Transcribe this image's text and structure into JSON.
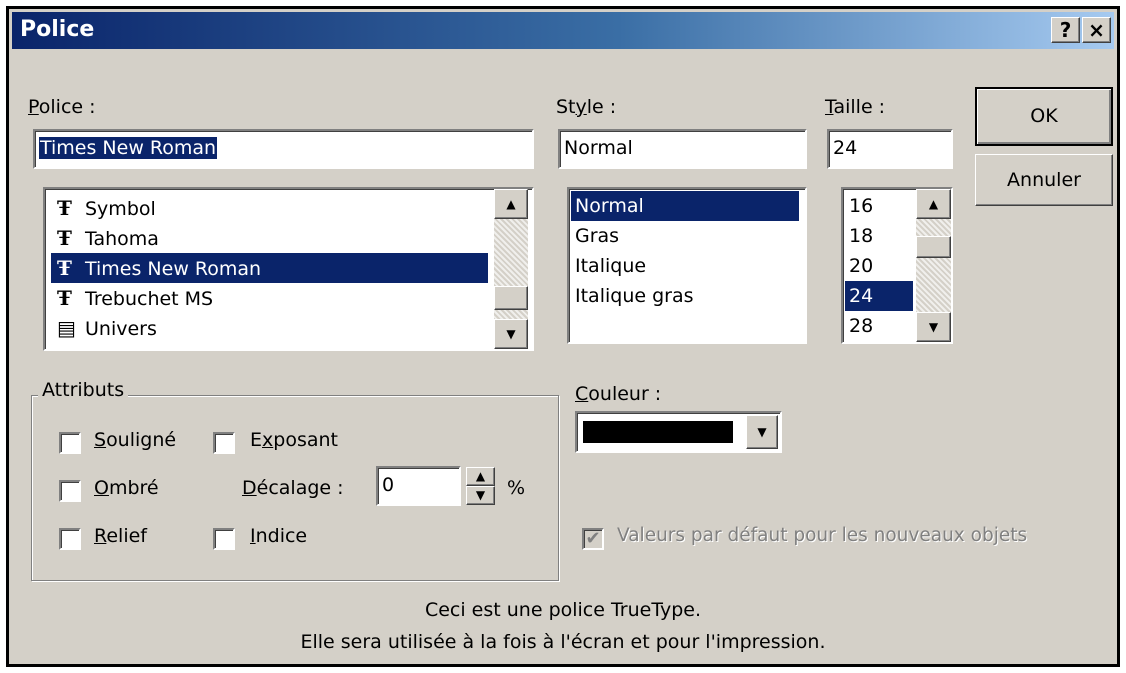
{
  "window": {
    "title": "Police",
    "help_label": "?",
    "close_label": "×"
  },
  "font": {
    "label": "Police :",
    "value": "Times New Roman",
    "list": [
      {
        "icon": "truetype-icon",
        "name": "Symbol"
      },
      {
        "icon": "truetype-icon",
        "name": "Tahoma"
      },
      {
        "icon": "truetype-icon",
        "name": "Times New Roman",
        "selected": true
      },
      {
        "icon": "truetype-icon",
        "name": "Trebuchet MS"
      },
      {
        "icon": "printer-font-icon",
        "name": "Univers"
      }
    ]
  },
  "style": {
    "label": "Style :",
    "value": "Normal",
    "list": [
      "Normal",
      "Gras",
      "Italique",
      "Italique gras"
    ],
    "selected": "Normal"
  },
  "size": {
    "label": "Taille :",
    "value": "24",
    "list": [
      "16",
      "18",
      "20",
      "24",
      "28"
    ],
    "selected": "24"
  },
  "buttons": {
    "ok": "OK",
    "cancel": "Annuler"
  },
  "attributes": {
    "legend": "Attributs",
    "underline": {
      "label": "Souligné",
      "checked": false
    },
    "superscript": {
      "label": "Exposant",
      "checked": false
    },
    "shadow": {
      "label": "Ombré",
      "checked": false
    },
    "offset_label": "Décalage :",
    "offset_value": "0",
    "offset_unit": "%",
    "emboss": {
      "label": "Relief",
      "checked": false
    },
    "subscript": {
      "label": "Indice",
      "checked": false
    }
  },
  "color": {
    "label": "Couleur :",
    "value_hex": "#000000"
  },
  "defaults": {
    "label": "Valeurs par défaut pour les nouveaux objets",
    "checked": true,
    "enabled": false
  },
  "info": {
    "line1": "Ceci est une police TrueType.",
    "line2": "Elle sera utilisée à la fois à l'écran et pour l'impression."
  }
}
